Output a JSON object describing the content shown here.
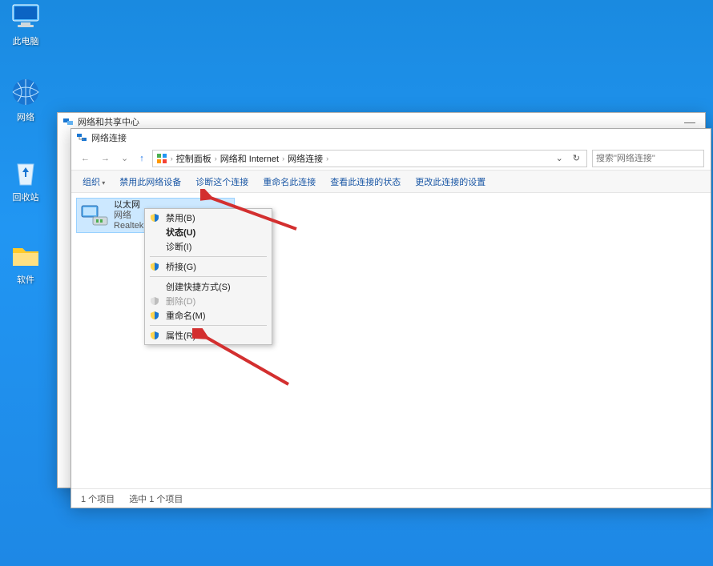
{
  "desktop": {
    "icons": [
      {
        "name": "computer",
        "label": "此电脑"
      },
      {
        "name": "network",
        "label": "网络"
      },
      {
        "name": "recycle",
        "label": "回收站"
      },
      {
        "name": "software",
        "label": "软件"
      }
    ]
  },
  "window_back": {
    "title": "网络和共享中心"
  },
  "window_front": {
    "title": "网络连接",
    "breadcrumb": {
      "segs": [
        "控制面板",
        "网络和 Internet",
        "网络连接"
      ]
    },
    "search_placeholder": "搜索\"网络连接\"",
    "toolbar": {
      "organize": "组织",
      "disable": "禁用此网络设备",
      "diagnose": "诊断这个连接",
      "rename": "重命名此连接",
      "status": "查看此连接的状态",
      "change": "更改此连接的设置"
    },
    "adapter": {
      "name": "以太网",
      "net": "网络",
      "dev": "Realtek"
    },
    "statusbar": {
      "count": "1 个项目",
      "selected": "选中 1 个项目"
    }
  },
  "context_menu": {
    "disable": "禁用(B)",
    "status": "状态(U)",
    "diagnose": "诊断(I)",
    "bridge": "桥接(G)",
    "shortcut": "创建快捷方式(S)",
    "delete": "删除(D)",
    "rename": "重命名(M)",
    "properties": "属性(R)"
  }
}
